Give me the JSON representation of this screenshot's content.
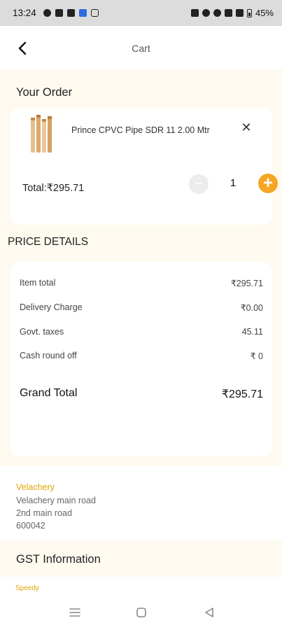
{
  "status_bar": {
    "time": "13:24",
    "battery": "45%"
  },
  "header": {
    "title": "Cart",
    "back_icon": "chevron-left-icon"
  },
  "order": {
    "section_title": "Your Order",
    "product_name": "Prince CPVC Pipe SDR 11  2.00 Mtr",
    "total_label": "Total:₹295.71",
    "quantity": "1",
    "minus_symbol": "−",
    "plus_symbol": "+",
    "remove_symbol": "✕"
  },
  "price_details": {
    "section_title": "PRICE DETAILS",
    "rows": [
      {
        "label": "Item total",
        "value": "₹295.71"
      },
      {
        "label": "Delivery Charge",
        "value": "₹0.00"
      },
      {
        "label": "Govt. taxes",
        "value": "45.11"
      },
      {
        "label": "Cash round off",
        "value": "₹ 0"
      }
    ],
    "grand_total_label": "Grand Total",
    "grand_total_value": "₹295.71"
  },
  "address": {
    "name": "Velachery",
    "lines": [
      "Velachery main road",
      "2nd main road",
      "600042"
    ]
  },
  "gst": {
    "section_title": "GST Information",
    "company": "Speedy"
  },
  "colors": {
    "accent": "#f5a623",
    "background": "#fffaf0",
    "card": "#ffffff"
  }
}
